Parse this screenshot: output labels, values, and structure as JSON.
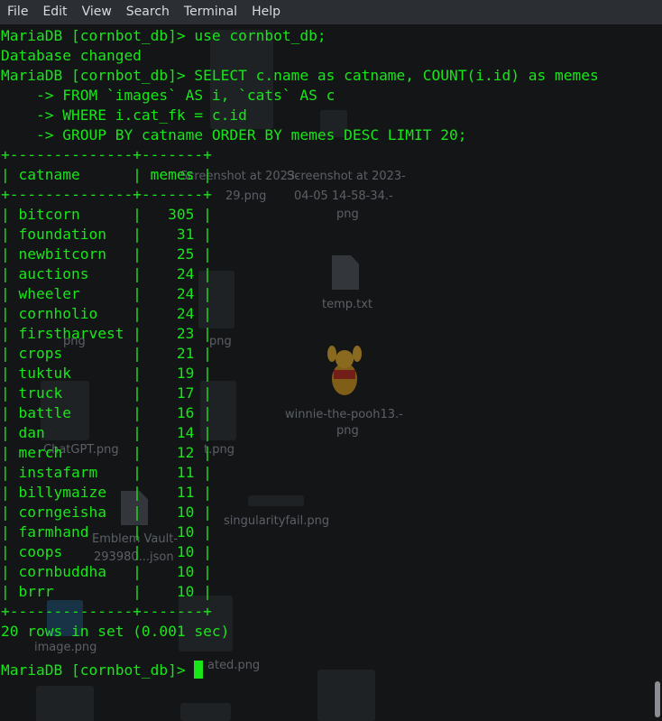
{
  "menu": {
    "items": [
      "File",
      "Edit",
      "View",
      "Search",
      "Terminal",
      "Help"
    ]
  },
  "desktop": {
    "labels": {
      "screenshot_a": "Screenshot at 2023-",
      "screenshot_a2": "29.png",
      "screenshot_b1": "Screenshot at 2023-",
      "screenshot_b2": "04-05 14-58-34.-",
      "screenshot_b3": "png",
      "temp": "temp.txt",
      "pooh1": "winnie-the-pooh13.-",
      "pooh2": "png",
      "chatgpt": "ChatGPT.png",
      "emblem1": "Emblem Vault-",
      "emblem2": "293980...json",
      "singularity": "singularityfail.png",
      "image": "image.png",
      "ated": "ated.png",
      "png_a": "png",
      "png_b": "png",
      "t_png": "t.png"
    }
  },
  "terminal": {
    "lines": [
      "MariaDB [cornbot_db]> use cornbot_db;",
      "Database changed",
      "MariaDB [cornbot_db]> SELECT c.name as catname, COUNT(i.id) as memes",
      "    -> FROM `images` AS i, `cats` AS c",
      "    -> WHERE i.cat_fk = c.id",
      "    -> GROUP BY catname ORDER BY memes DESC LIMIT 20;",
      "+--------------+-------+",
      "| catname      | memes |",
      "+--------------+-------+",
      "| bitcorn      |   305 |",
      "| foundation   |    31 |",
      "| newbitcorn   |    25 |",
      "| auctions     |    24 |",
      "| wheeler      |    24 |",
      "| cornholio    |    24 |",
      "| firstharvest |    23 |",
      "| crops        |    21 |",
      "| tuktuk       |    19 |",
      "| truck        |    17 |",
      "| battle       |    16 |",
      "| dan          |    14 |",
      "| merch        |    12 |",
      "| instafarm    |    11 |",
      "| billymaize   |    11 |",
      "| corngeisha   |    10 |",
      "| farmhand     |    10 |",
      "| coops        |    10 |",
      "| cornbuddha   |    10 |",
      "| brrr         |    10 |",
      "+--------------+-------+",
      "20 rows in set (0.001 sec)",
      "",
      "MariaDB [cornbot_db]> "
    ]
  },
  "colors": {
    "terminal_text": "#19e619",
    "menubar_bg": "#2b2e33",
    "background": "#0f1113"
  }
}
